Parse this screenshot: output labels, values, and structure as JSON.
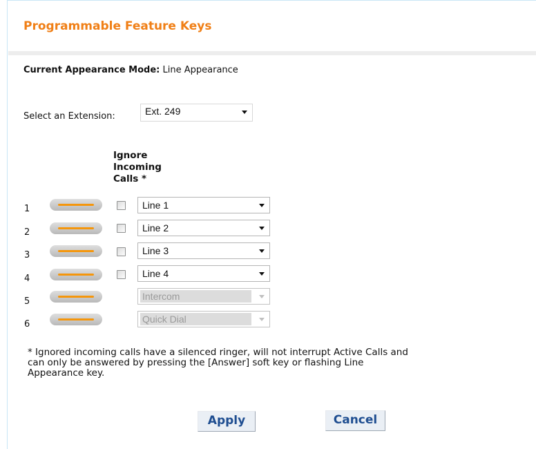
{
  "page": {
    "title": "Programmable Feature Keys",
    "mode_label": "Current Appearance Mode:",
    "mode_value": " Line Appearance"
  },
  "extension": {
    "label": "Select an Extension:",
    "selected": "Ext. 249"
  },
  "column_header": [
    "Ignore",
    "Incoming",
    "Calls *"
  ],
  "keys": [
    {
      "number": "1",
      "ignore_checked": false,
      "has_checkbox": true,
      "assignment": "Line 1",
      "disabled": false
    },
    {
      "number": "2",
      "ignore_checked": false,
      "has_checkbox": true,
      "assignment": "Line 2",
      "disabled": false
    },
    {
      "number": "3",
      "ignore_checked": false,
      "has_checkbox": true,
      "assignment": "Line 3",
      "disabled": false
    },
    {
      "number": "4",
      "ignore_checked": false,
      "has_checkbox": true,
      "assignment": "Line 4",
      "disabled": false
    },
    {
      "number": "5",
      "has_checkbox": false,
      "assignment": "Intercom",
      "disabled": true
    },
    {
      "number": "6",
      "has_checkbox": false,
      "assignment": "Quick Dial",
      "disabled": true
    }
  ],
  "footnote": [
    "* Ignored incoming calls have a silenced ringer, will not interrupt Active Calls and",
    "can only be answered by pressing the [Answer] soft key or flashing Line",
    "Appearance key."
  ],
  "buttons": {
    "apply": "Apply",
    "cancel": "Cancel"
  },
  "colors": {
    "title": "#f07f16",
    "key_led": "#f5960b",
    "button_text": "#1f4e91"
  },
  "icons": {
    "dropdown": "chevron-down-icon"
  }
}
